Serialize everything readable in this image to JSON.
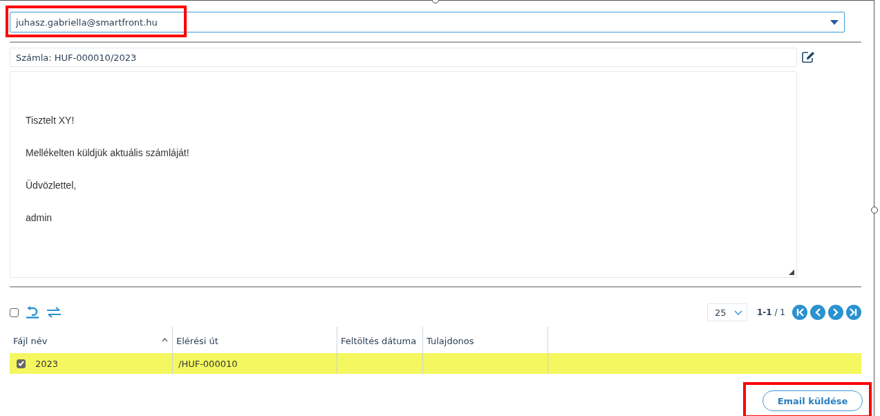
{
  "recipient": {
    "value": "juhasz.gabriella@smartfront.hu"
  },
  "subject": {
    "value": "Számla: HUF-000010/2023"
  },
  "message": {
    "paragraphs": [
      "Tisztelt XY!",
      "Mellékelten küldjük aktuális számláját!",
      "Üdvözlettel,",
      "admin"
    ]
  },
  "toolbar": {
    "select_all_checked": false
  },
  "pagination": {
    "page_size": "25",
    "range": "**1-1** / 1"
  },
  "table": {
    "columns": [
      {
        "label": "Fájl név",
        "sorted": true
      },
      {
        "label": "Elérési út",
        "sorted": false
      },
      {
        "label": "Feltöltés dátuma",
        "sorted": false
      },
      {
        "label": "Tulajdonos",
        "sorted": false
      }
    ],
    "rows": [
      {
        "checked": true,
        "selected": true,
        "cells": [
          "2023",
          "/HUF-000010",
          "",
          ""
        ]
      }
    ]
  },
  "send_button": {
    "label": "Email küldése"
  }
}
